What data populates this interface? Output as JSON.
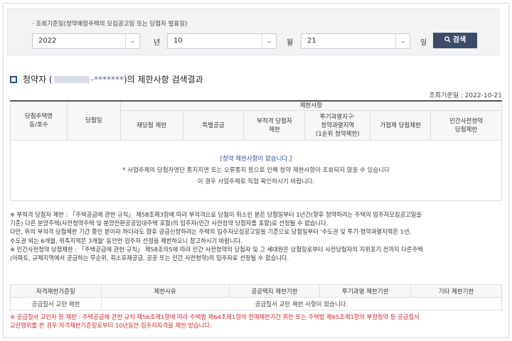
{
  "search": {
    "label": "· 조회기준일(청약예정주택의 모집공고일 또는 당첨자 발표일)",
    "year_value": "2022",
    "year_unit": "년",
    "month_value": "10",
    "month_unit": "월",
    "day_value": "21",
    "day_unit": "일",
    "button_label": "검색"
  },
  "result": {
    "title_prefix": "청약자 (",
    "title_mask": "-*******",
    "title_suffix": ")의 제한사항 검색결과",
    "ref_date": "조회기준일 : 2022-10-21",
    "headers": {
      "unit": "당첨주택명\n동/호수",
      "win_date": "당첨일",
      "restriction": "제한사항",
      "rewin": "재당첨 제한",
      "special": "특별공급",
      "ineligible": "부적격 당첨자\n제한",
      "overheat": "투기과열지구·\n청약과열지역\n(1순위 청약제한)",
      "add_point": "가점제 당첨제한",
      "presale": "민간사전청약\n당첨제한"
    },
    "empty_line1": "[청약 제한사항이 없습니다.]",
    "empty_line2": "* 사업주체의 당첨자명단 통지지연 또는 오류통지 등으로 인해 청약 제한사항이 조회되지 않을 수 있습니다",
    "empty_line3": "이 경우 사업주체로 직접 확인하시기 바랍니다."
  },
  "notes": [
    "※ 부적격 당첨자 제한 : 「주택공급에 관한 규칙」 제58조제3항에 따라 부적격으로 당첨이 취소된 분은 당첨일부터 1년간(향후 청약하려는 주택의 입주자모집공고일을",
    "기준) 다른 분양주택(사전청약주택 및 분양전환공공임대주택 포함)의 입주자(민간 사전청약 당첨자를 포함)로 선정될 수 없습니다.",
    "다만, 위의 부적격 당첨제한 기간 중인 분이라 하더라도 향후 공급신청하려는 주택의 입주자모집공고일을 기준으로 당첨일부터 '수도권 및 투기·청약과열지역은 1년,",
    "수도권 외는 6개월, 위축지역은 3개월' 동안만 입주자 선정을 제한하오니 참고하시기 바랍니다.",
    "※ 민간사전청약 당첨제한 : 「주택공급에 관한 규칙」 제58조의5에 따라 민간 사전청약의 당첨자 및 그 세대원은 당첨일로부터 사전당첨자의 지위포기 전까지 다른주택",
    "(아파트, 규제지역에서 공급하는 무순위, 취소후재공급, 공공 또는 민간 사전청약)의 입주자로 선정될 수 없습니다."
  ],
  "bottom": {
    "headers": [
      "자격제한기준일",
      "제한사유",
      "공공택지 제한기한",
      "투기과열 제한기한",
      "기타 제한기한"
    ],
    "row_label": "공급질서 교란 제한",
    "row_value": "공급질서 교란 제한 사항이 없습니다."
  },
  "red_note": [
    "※ 공급질서 교란자 등 제한 : 주택공급에 관한 규칙 제56조제1항에 따라 주택법 제64조제1항의 전매제한기간 위반 또는 주택법 제65조제1항의 부정청약 등 공급질서",
    "교란행위를 한 경우 자격제한기준일로부터 10년동안 입주자자격을 제한 받습니다."
  ],
  "colors": {
    "search_button": "#3c4c68",
    "accent_blue": "#1f4fa0",
    "warning_red": "#d0252a"
  }
}
